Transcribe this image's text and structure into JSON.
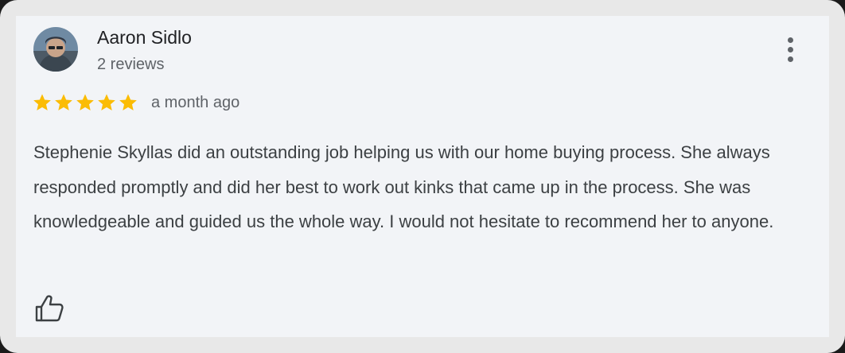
{
  "review": {
    "author_name": "Aaron Sidlo",
    "author_reviews": "2 reviews",
    "rating": 5,
    "rating_max": 5,
    "time_ago": "a month ago",
    "text": "Stephenie Skyllas did an outstanding job helping us with our home buying process. She always responded promptly and did her best to work out kinks that came up in the process. She was knowledgeable and guided us the whole way. I would not hesitate to recommend her to anyone."
  },
  "icons": {
    "menu": "more-vert-icon",
    "like": "thumb-up-icon",
    "star": "star-icon"
  },
  "colors": {
    "star": "#fbbc04",
    "name": "#202124",
    "secondary": "#5f6368",
    "body_text": "#3c4043",
    "card_bg": "#f2f4f7"
  }
}
